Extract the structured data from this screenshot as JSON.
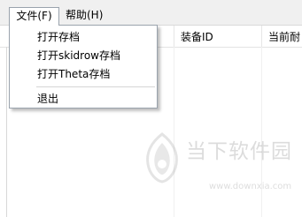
{
  "menubar": {
    "file_label": "文件(F)",
    "help_label": "帮助(H)"
  },
  "file_menu": {
    "items": [
      "打开存档",
      "打开skidrow存档",
      "打开Theta存档",
      "退出"
    ]
  },
  "list": {
    "columns": [
      "装备ID",
      "当前耐"
    ]
  },
  "watermark": {
    "brand_text": "当下软件园",
    "url": "www.downxia.com",
    "brand_icon": "downxia-logo-icon"
  }
}
